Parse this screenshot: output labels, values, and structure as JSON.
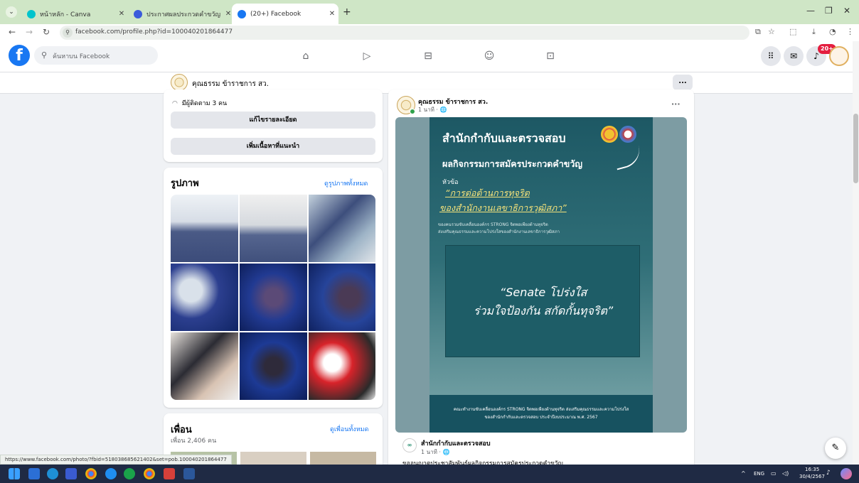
{
  "browser": {
    "tabs": [
      {
        "label": "หน้าหลัก - Canva",
        "active": false,
        "color": "#00c4cc"
      },
      {
        "label": "ประกาศผลประกวดคำขวัญ - โปสเตอร์",
        "active": false,
        "color": "#3b5bdb"
      },
      {
        "label": "(20+) Facebook",
        "active": true,
        "color": "#1877f2"
      }
    ],
    "url": "facebook.com/profile.php?id=100040201864477",
    "status_url": "https://www.facebook.com/photo/?fbid=518038685621402&set=pob.100040201864477"
  },
  "fb": {
    "logo": "f",
    "search_placeholder": "ค้นหาบน Facebook",
    "notification_count": "20+",
    "brand_color": "#1877f2"
  },
  "profile": {
    "name": "คุณธรรม ข้าราชการ สว.",
    "more_label": "..."
  },
  "intro": {
    "followers": "มีผู้ติดตาม 3 คน",
    "edit_details": "แก้ไขรายละเอียด",
    "add_featured": "เพิ่มเนื้อหาที่แนะนำ"
  },
  "photos": {
    "title": "รูปภาพ",
    "see_all": "ดูรูปภาพทั้งหมด"
  },
  "friends": {
    "title": "เพื่อน",
    "count": "เพื่อน 2,406 คน",
    "see_all": "ดูเพื่อนทั้งหมด"
  },
  "post": {
    "author": "คุณธรรม ข้าราชการ สว.",
    "time": "1 นาที · 🌐",
    "more": "···",
    "poster": {
      "title": "สำนักกำกับและตรวจสอบ",
      "subtitle": "ผลกิจกรรมการสมัครประกวดคำขวัญ",
      "topic_label": "หัวข้อ",
      "topic_line1": "“การต่อต้านการทุจริต",
      "topic_line2": "ของสำนักงานเลขาธิการวุฒิสภา”",
      "small_line1": "ของคนรวมขับเคลื่อนองค์กร STRONG จิตพอเพียงต้านทุจริต",
      "small_line2": "ส่งเสริมคุณธรรมและความโปร่งใสของสำนักงานเลขาธิการวุฒิสภา",
      "quote_line1": "“Senate โปร่งใส",
      "quote_line2": "ร่วมใจป้องกัน สกัดกั้นทุจริต”",
      "footer_line1": "คณะทำงานขับเคลื่อนองค์กร STRONG จิตพอเพียงต้านทุจริต ส่งเสริมคุณธรรมและความโปร่งใส",
      "footer_line2": "ของสำนักกำกับและตรวจสอบ ประจำปีงบประมาณ พ.ศ. 2567"
    },
    "shared": {
      "page": "สำนักกำกับและตรวจสอบ",
      "time": "1 นาที · 🌐",
      "text": "ขออนุญาตประชาสัมพันธ์ผลกิจกรรมการสมัครประกวดคำขวัญ"
    }
  },
  "taskbar": {
    "lang": "ENG",
    "time": "16:35",
    "date": "30/4/2567"
  }
}
